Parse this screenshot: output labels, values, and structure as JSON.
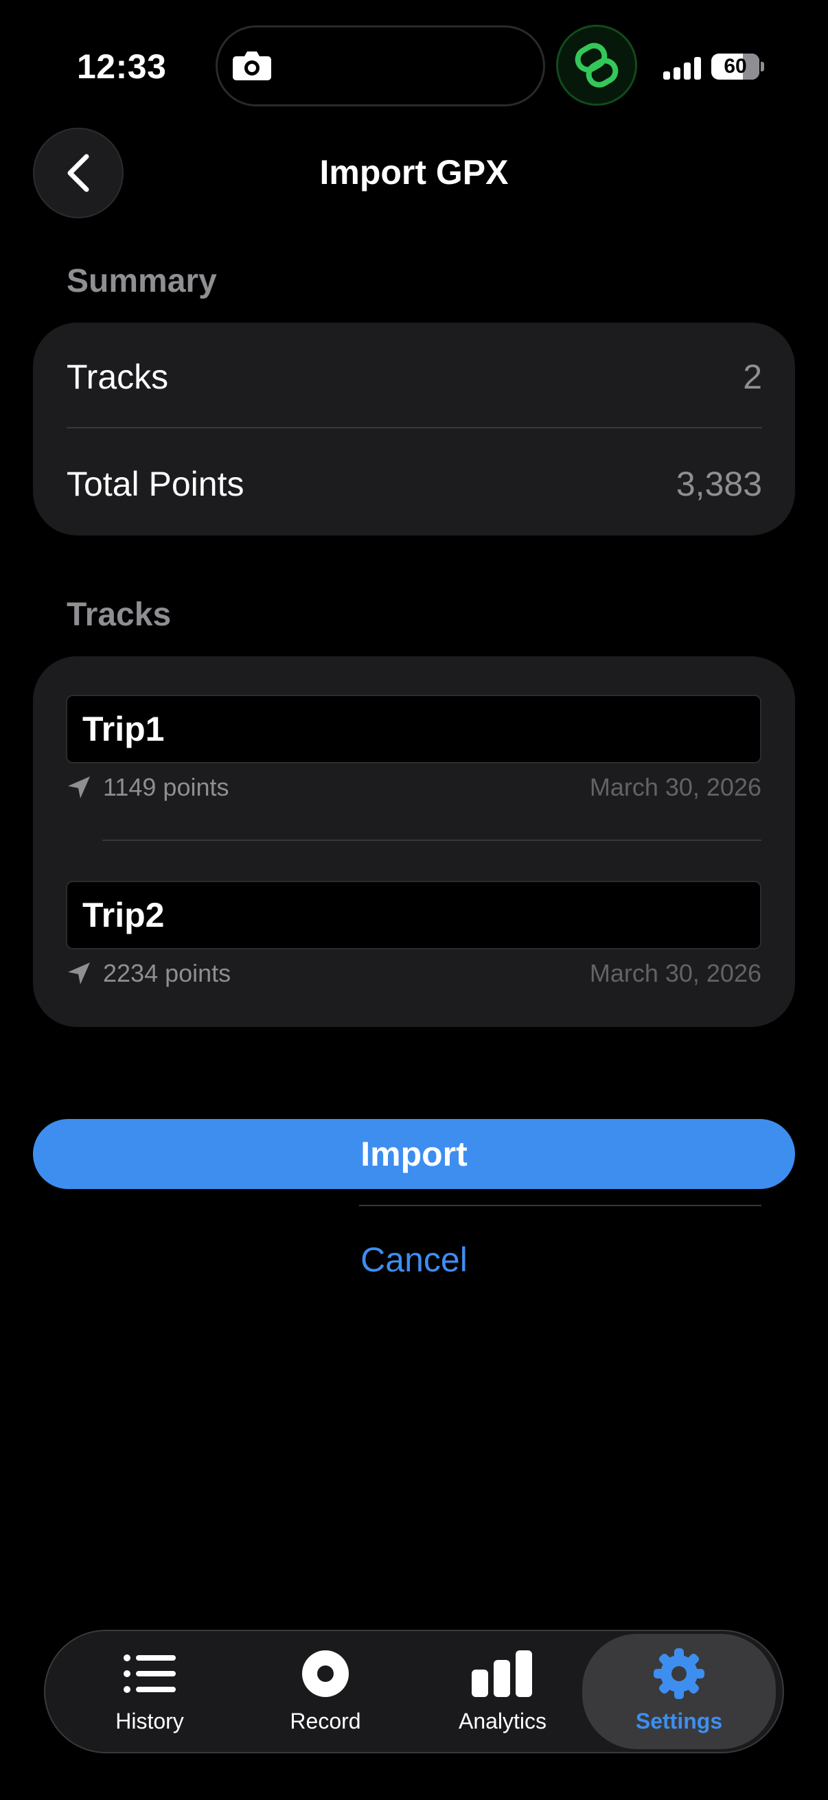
{
  "status_bar": {
    "time": "12:33",
    "battery": "60"
  },
  "header": {
    "title": "Import GPX"
  },
  "summary": {
    "section_label": "Summary",
    "rows": [
      {
        "label": "Tracks",
        "value": "2"
      },
      {
        "label": "Total Points",
        "value": "3,383"
      }
    ]
  },
  "tracks": {
    "section_label": "Tracks",
    "items": [
      {
        "name": "Trip1",
        "points": "1149 points",
        "date": "March 30, 2026"
      },
      {
        "name": "Trip2",
        "points": "2234 points",
        "date": "March 30, 2026"
      }
    ]
  },
  "actions": {
    "import_label": "Import",
    "cancel_label": "Cancel"
  },
  "tab_bar": {
    "tabs": [
      {
        "label": "History",
        "icon": "list-icon"
      },
      {
        "label": "Record",
        "icon": "record-icon"
      },
      {
        "label": "Analytics",
        "icon": "bar-chart-icon"
      },
      {
        "label": "Settings",
        "icon": "gear-icon",
        "active": true
      }
    ]
  },
  "colors": {
    "accent": "#3e8ef0",
    "background": "#000000",
    "card": "#1c1c1e",
    "secondary_text": "#8e8e93"
  }
}
